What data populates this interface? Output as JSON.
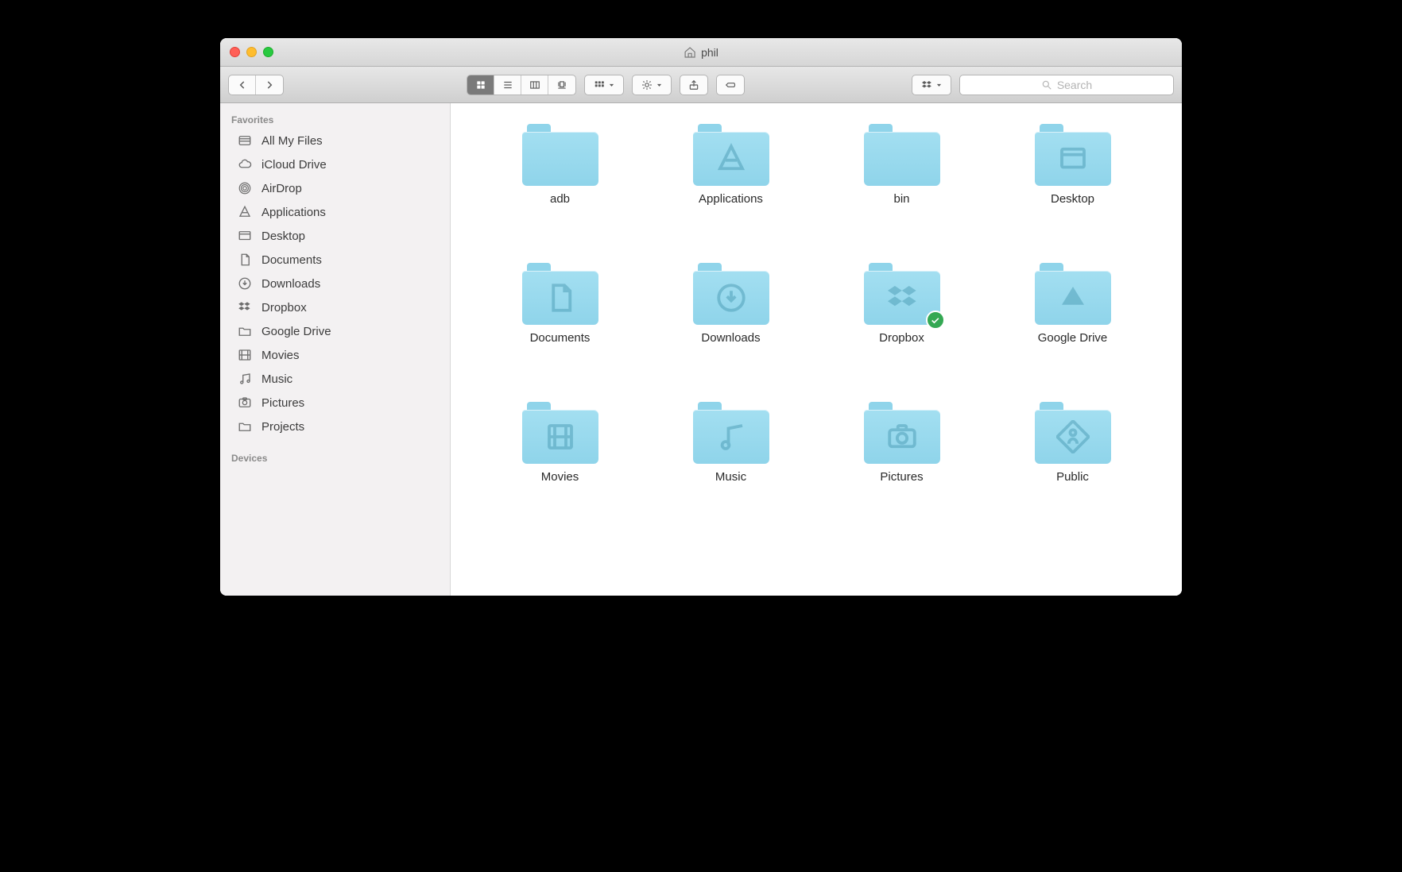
{
  "window": {
    "title": "phil"
  },
  "search": {
    "placeholder": "Search"
  },
  "sidebar": {
    "sections": [
      {
        "header": "Favorites",
        "items": [
          {
            "icon": "all-my-files",
            "label": "All My Files"
          },
          {
            "icon": "icloud",
            "label": "iCloud Drive"
          },
          {
            "icon": "airdrop",
            "label": "AirDrop"
          },
          {
            "icon": "applications",
            "label": "Applications"
          },
          {
            "icon": "desktop",
            "label": "Desktop"
          },
          {
            "icon": "documents",
            "label": "Documents"
          },
          {
            "icon": "downloads",
            "label": "Downloads"
          },
          {
            "icon": "dropbox",
            "label": "Dropbox"
          },
          {
            "icon": "folder",
            "label": "Google Drive"
          },
          {
            "icon": "movies",
            "label": "Movies"
          },
          {
            "icon": "music",
            "label": "Music"
          },
          {
            "icon": "pictures",
            "label": "Pictures"
          },
          {
            "icon": "folder",
            "label": "Projects"
          }
        ]
      },
      {
        "header": "Devices",
        "items": []
      }
    ]
  },
  "folders": [
    {
      "name": "adb",
      "glyph": ""
    },
    {
      "name": "Applications",
      "glyph": "app"
    },
    {
      "name": "bin",
      "glyph": ""
    },
    {
      "name": "Desktop",
      "glyph": "desktop"
    },
    {
      "name": "Documents",
      "glyph": "doc"
    },
    {
      "name": "Downloads",
      "glyph": "download"
    },
    {
      "name": "Dropbox",
      "glyph": "dropbox",
      "synced": true
    },
    {
      "name": "Google Drive",
      "glyph": "gdrive"
    },
    {
      "name": "Movies",
      "glyph": "movie"
    },
    {
      "name": "Music",
      "glyph": "music"
    },
    {
      "name": "Pictures",
      "glyph": "camera"
    },
    {
      "name": "Public",
      "glyph": "public"
    }
  ]
}
